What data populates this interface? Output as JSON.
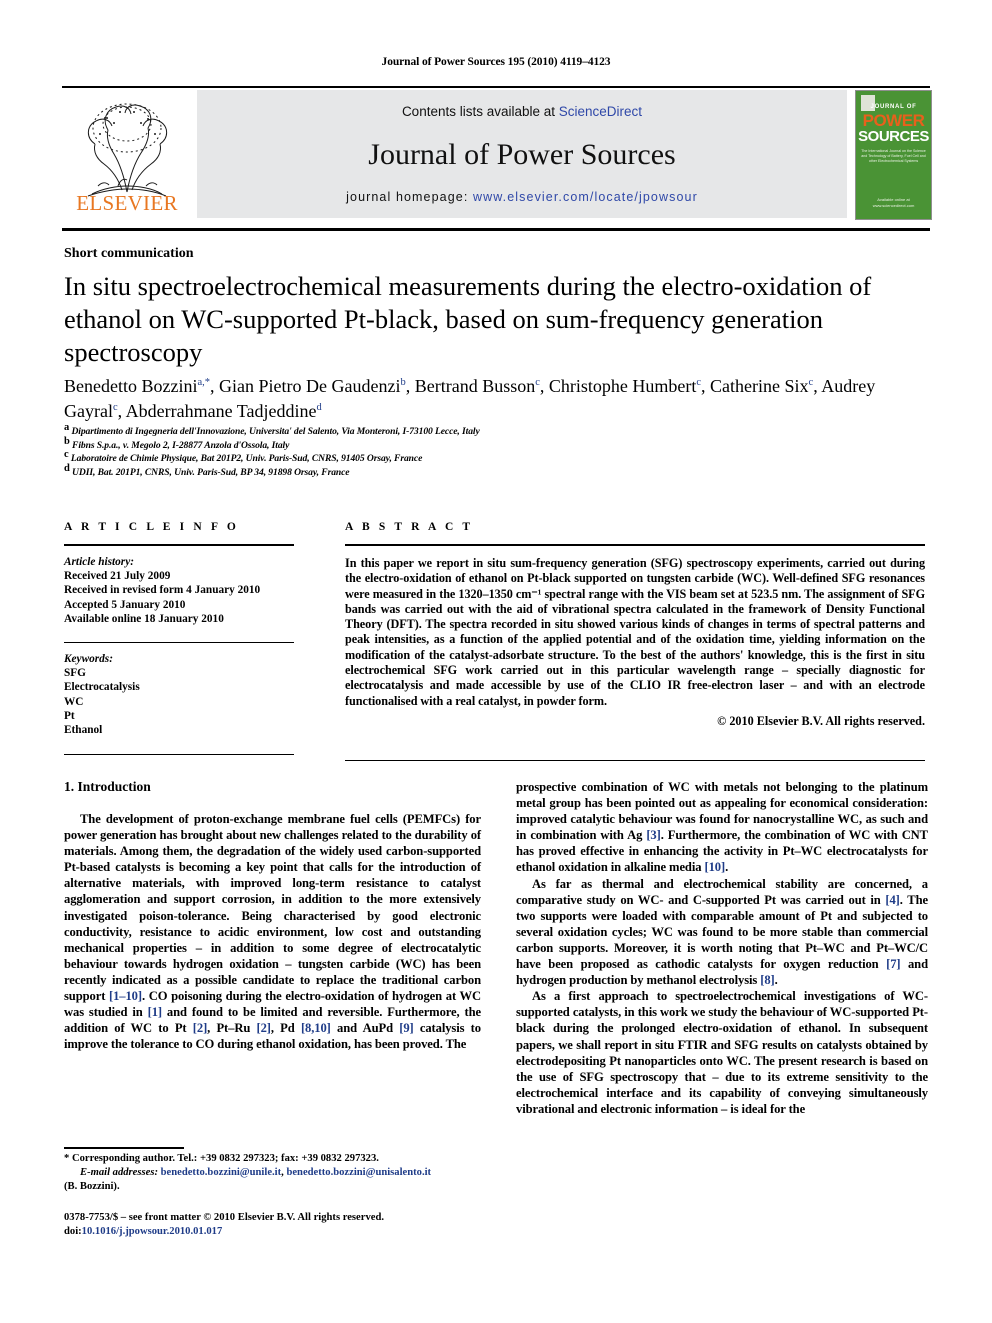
{
  "running_head": "Journal of Power Sources 195 (2010) 4119–4123",
  "masthead": {
    "contents_prefix": "Contents lists available at ",
    "sciencedirect": "ScienceDirect",
    "journal_title": "Journal of Power Sources",
    "homepage_label": "journal homepage:",
    "homepage_url": "www.elsevier.com/locate/jpowsour",
    "publisher_wordmark": "ELSEVIER",
    "cover": {
      "journal_of": "JOURNAL OF",
      "power": "POWER",
      "sources": "SOURCES",
      "subtitle": "The International Journal on the Science and Technology of Battery, Fuel Cell and other Electrochemical Systems",
      "sciencedirect": "Available online at www.sciencedirect.com"
    }
  },
  "article": {
    "section_type": "Short communication",
    "title": "In situ spectroelectrochemical measurements during the electro-oxidation of ethanol on WC-supported Pt-black, based on sum-frequency generation spectroscopy",
    "authors": [
      {
        "name": "Benedetto Bozzini",
        "marks": "a,*"
      },
      {
        "name": "Gian Pietro De Gaudenzi",
        "marks": "b"
      },
      {
        "name": "Bertrand Busson",
        "marks": "c"
      },
      {
        "name": "Christophe Humbert",
        "marks": "c"
      },
      {
        "name": "Catherine Six",
        "marks": "c"
      },
      {
        "name": "Audrey Gayral",
        "marks": "c"
      },
      {
        "name": "Abderrahmane Tadjeddine",
        "marks": "d"
      }
    ],
    "affiliations": [
      {
        "mark": "a",
        "text": "Dipartimento di Ingegneria dell'Innovazione, Universita' del Salento, Via Monteroni, I-73100 Lecce, Italy"
      },
      {
        "mark": "b",
        "text": "Fibns S.p.a., v. Megolo 2, I-28877 Anzola d'Ossola, Italy"
      },
      {
        "mark": "c",
        "text": "Laboratoire de Chimie Physique, Bat 201P2, Univ. Paris-Sud, CNRS, 91405 Orsay, France"
      },
      {
        "mark": "d",
        "text": "UDII, Bat. 201P1, CNRS, Univ. Paris-Sud, BP 34, 91898 Orsay, France"
      }
    ]
  },
  "article_info": {
    "label": "A R T I C L E    I N F O",
    "history_label": "Article history:",
    "history": [
      "Received 21 July 2009",
      "Received in revised form 4 January 2010",
      "Accepted 5 January 2010",
      "Available online 18 January 2010"
    ],
    "keywords_label": "Keywords:",
    "keywords": [
      "SFG",
      "Electrocatalysis",
      "WC",
      "Pt",
      "Ethanol"
    ]
  },
  "abstract": {
    "label": "A B S T R A C T",
    "text": "In this paper we report in situ sum-frequency generation (SFG) spectroscopy experiments, carried out during the electro-oxidation of ethanol on Pt-black supported on tungsten carbide (WC). Well-defined SFG resonances were measured in the 1320–1350 cm⁻¹ spectral range with the VIS beam set at 523.5 nm. The assignment of SFG bands was carried out with the aid of vibrational spectra calculated in the framework of Density Functional Theory (DFT). The spectra recorded in situ showed various kinds of changes in terms of spectral patterns and peak intensities, as a function of the applied potential and of the oxidation time, yielding information on the modification of the catalyst-adsorbate structure. To the best of the authors' knowledge, this is the first in situ electrochemical SFG work carried out in this particular wavelength range – specially diagnostic for electrocatalysis and made accessible by use of the CLIO IR free-electron laser – and with an electrode functionalised with a real catalyst, in powder form.",
    "copyright": "© 2010 Elsevier B.V. All rights reserved."
  },
  "body": {
    "intro_heading": "1.  Introduction",
    "left_paragraphs": [
      "The development of proton-exchange membrane fuel cells (PEMFCs) for power generation has brought about new challenges related to the durability of materials. Among them, the degradation of the widely used carbon-supported Pt-based catalysts is becoming a key point that calls for the introduction of alternative materials, with improved long-term resistance to catalyst agglomeration and support corrosion, in addition to the more extensively investigated poison-tolerance. Being characterised by good electronic conductivity, resistance to acidic environment, low cost and outstanding mechanical properties – in addition to some degree of electrocatalytic behaviour towards hydrogen oxidation – tungsten carbide (WC) has been recently indicated as a possible candidate to replace the traditional carbon support [1–10]. CO poisoning during the electro-oxidation of hydrogen at WC was studied in [1] and found to be limited and reversible. Furthermore, the addition of WC to Pt [2], Pt–Ru [2], Pd [8,10] and AuPd [9] catalysis to improve the tolerance to CO during ethanol oxidation, has been proved. The"
    ],
    "right_paragraphs": [
      "prospective combination of WC with metals not belonging to the platinum metal group has been pointed out as appealing for economical consideration: improved catalytic behaviour was found for nanocrystalline WC, as such and in combination with Ag [3]. Furthermore, the combination of WC with CNT has proved effective in enhancing the activity in Pt–WC electrocatalysts for ethanol oxidation in alkaline media [10].",
      "As far as thermal and electrochemical stability are concerned, a comparative study on WC- and C-supported Pt was carried out in [4]. The two supports were loaded with comparable amount of Pt and subjected to several oxidation cycles; WC was found to be more stable than commercial carbon supports. Moreover, it is worth noting that Pt–WC and Pt–WC/C have been proposed as cathodic catalysts for oxygen reduction [7] and hydrogen production by methanol electrolysis [8].",
      "As a first approach to spectroelectrochemical investigations of WC-supported catalysts, in this work we study the behaviour of WC-supported Pt-black during the prolonged electro-oxidation of ethanol. In subsequent papers, we shall report in situ FTIR and SFG results on catalysts obtained by electrodepositing Pt nanoparticles onto WC. The present research is based on the use of SFG spectroscopy that – due to its extreme sensitivity to the electrochemical interface and its capability of conveying simultaneously vibrational and electronic information – is ideal for the"
    ]
  },
  "footnotes": {
    "corresponding": "* Corresponding author. Tel.: +39 0832 297323; fax: +39 0832 297323.",
    "email_label": "E-mail addresses:",
    "email1": "benedetto.bozzini@unile.it",
    "email2": "benedetto.bozzini@unisalento.it",
    "email_attrib": "(B. Bozzini).",
    "issn_line": "0378-7753/$ – see front matter © 2010 Elsevier B.V. All rights reserved.",
    "doi_label": "doi:",
    "doi_value": "10.1016/j.jpowsour.2010.01.017"
  },
  "colors": {
    "link": "#1f3c88",
    "elsevier_orange": "#E87722",
    "cover_green": "#4a9335"
  }
}
